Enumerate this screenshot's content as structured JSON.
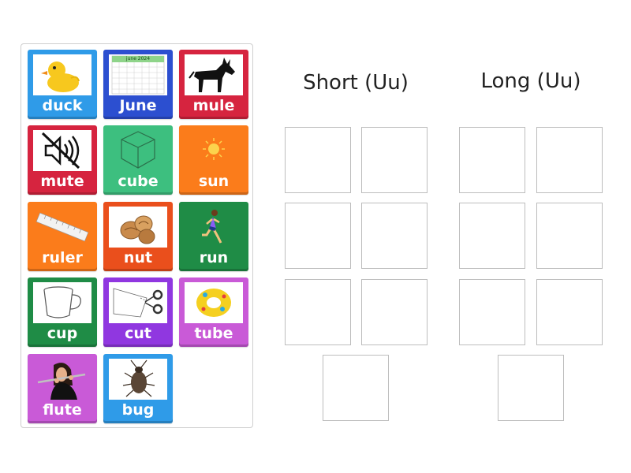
{
  "groups": {
    "short_title": "Short (Uu)",
    "long_title": "Long (Uu)"
  },
  "colors": {
    "blue": "#2f9be8",
    "navy": "#2c4fd0",
    "red": "#d6243f",
    "green_light": "#3dbf7f",
    "orange": "#fb7c1b",
    "orange_red": "#ea4f1c",
    "green_dark": "#1f8c46",
    "purple": "#9037e0",
    "magenta": "#c95ad7"
  },
  "cards": [
    {
      "label": "duck",
      "icon": "rubber-duck-icon",
      "color": "#2f9be8"
    },
    {
      "label": "June",
      "icon": "calendar-icon",
      "color": "#2c4fd0"
    },
    {
      "label": "mule",
      "icon": "mule-icon",
      "color": "#d6243f"
    },
    {
      "label": "mute",
      "icon": "mute-speaker-icon",
      "color": "#d6243f"
    },
    {
      "label": "cube",
      "icon": "cube-icon",
      "color": "#3dbf7f"
    },
    {
      "label": "sun",
      "icon": "sun-icon",
      "color": "#fb7c1b"
    },
    {
      "label": "ruler",
      "icon": "ruler-icon",
      "color": "#fb7c1b"
    },
    {
      "label": "nut",
      "icon": "walnut-icon",
      "color": "#ea4f1c"
    },
    {
      "label": "run",
      "icon": "runner-icon",
      "color": "#1f8c46"
    },
    {
      "label": "cup",
      "icon": "cup-icon",
      "color": "#1f8c46"
    },
    {
      "label": "cut",
      "icon": "scissors-cut-icon",
      "color": "#9037e0"
    },
    {
      "label": "tube",
      "icon": "swim-tube-icon",
      "color": "#c95ad7"
    },
    {
      "label": "flute",
      "icon": "flute-player-icon",
      "color": "#c95ad7"
    },
    {
      "label": "bug",
      "icon": "bug-icon",
      "color": "#2f9be8"
    }
  ],
  "calendar_title": "june 2024"
}
